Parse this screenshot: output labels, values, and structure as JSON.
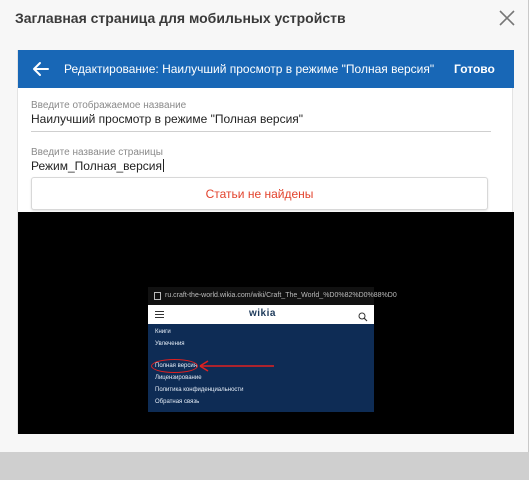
{
  "modal": {
    "title": "Заглавная страница для мобильных устройств"
  },
  "editor": {
    "header_title": "Редактирование: Наилучший просмотр в режиме \"Полная версия\"",
    "done_label": "Готово",
    "display_name_label": "Введите отображаемое название",
    "display_name_value": "Наилучший просмотр в режиме \"Полная версия\"",
    "page_name_label": "Введите название страницы",
    "page_name_value": "Режим_Полная_версия",
    "not_found_text": "Статьи не найдены"
  },
  "preview": {
    "url": "ru.craft-the-world.wikia.com/wiki/Craft_The_World_%D0%82%D0%88%D0",
    "logo": "wikia",
    "menu_items": [
      "Книги",
      "Увлечения",
      "Полная версия",
      "Лицензирование",
      "Политика конфиденциальности",
      "Обратная связь"
    ]
  },
  "colors": {
    "accent": "#1867b6",
    "error": "#e2422c",
    "highlight": "#e02020"
  },
  "icons": {
    "close": "close-icon",
    "back": "arrow-left-icon",
    "search": "search-icon"
  }
}
